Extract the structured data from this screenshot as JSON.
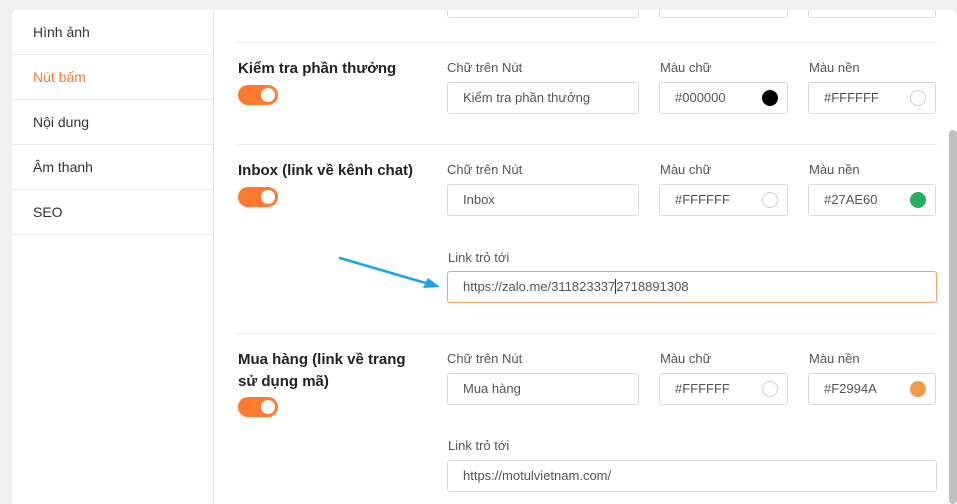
{
  "sidebar": {
    "items": [
      {
        "label": "Hình ảnh",
        "active": false
      },
      {
        "label": "Nút bấm",
        "active": true
      },
      {
        "label": "Nội dung",
        "active": false
      },
      {
        "label": "Âm thanh",
        "active": false
      },
      {
        "label": "SEO",
        "active": false
      }
    ]
  },
  "sections": {
    "reward": {
      "title": "Kiểm tra phần thưởng",
      "button_text_label": "Chữ trên Nút",
      "button_text_value": "Kiểm tra phần thưởng",
      "text_color_label": "Màu chữ",
      "text_color_value": "#000000",
      "text_color_swatch": "#000000",
      "bg_color_label": "Màu nền",
      "bg_color_value": "#FFFFFF",
      "bg_color_swatch": "#FFFFFF",
      "enabled": true
    },
    "inbox": {
      "title": "Inbox (link về kênh chat)",
      "button_text_label": "Chữ trên Nút",
      "button_text_value": "Inbox",
      "text_color_label": "Màu chữ",
      "text_color_value": "#FFFFFF",
      "text_color_swatch": "#FFFFFF",
      "bg_color_label": "Màu nền",
      "bg_color_value": "#27AE60",
      "bg_color_swatch": "#27AE60",
      "link_label": "Link trỏ tới",
      "link_value_before_cursor": "https://zalo.me/311823337",
      "link_value_after_cursor": "2718891308",
      "enabled": true
    },
    "buy": {
      "title_line1": "Mua hàng (link về trang",
      "title_line2": "sử dụng mã)",
      "button_text_label": "Chữ trên Nút",
      "button_text_value": "Mua hàng",
      "text_color_label": "Màu chữ",
      "text_color_value": "#FFFFFF",
      "text_color_swatch": "#FFFFFF",
      "bg_color_label": "Màu nền",
      "bg_color_value": "#F2994A",
      "bg_color_swatch": "#F2994A",
      "link_label": "Link trỏ tới",
      "link_value": "https://motulvietnam.com/",
      "enabled": true
    }
  },
  "colors": {
    "accent": "#FF7A30",
    "arrow": "#1AA3E8"
  }
}
